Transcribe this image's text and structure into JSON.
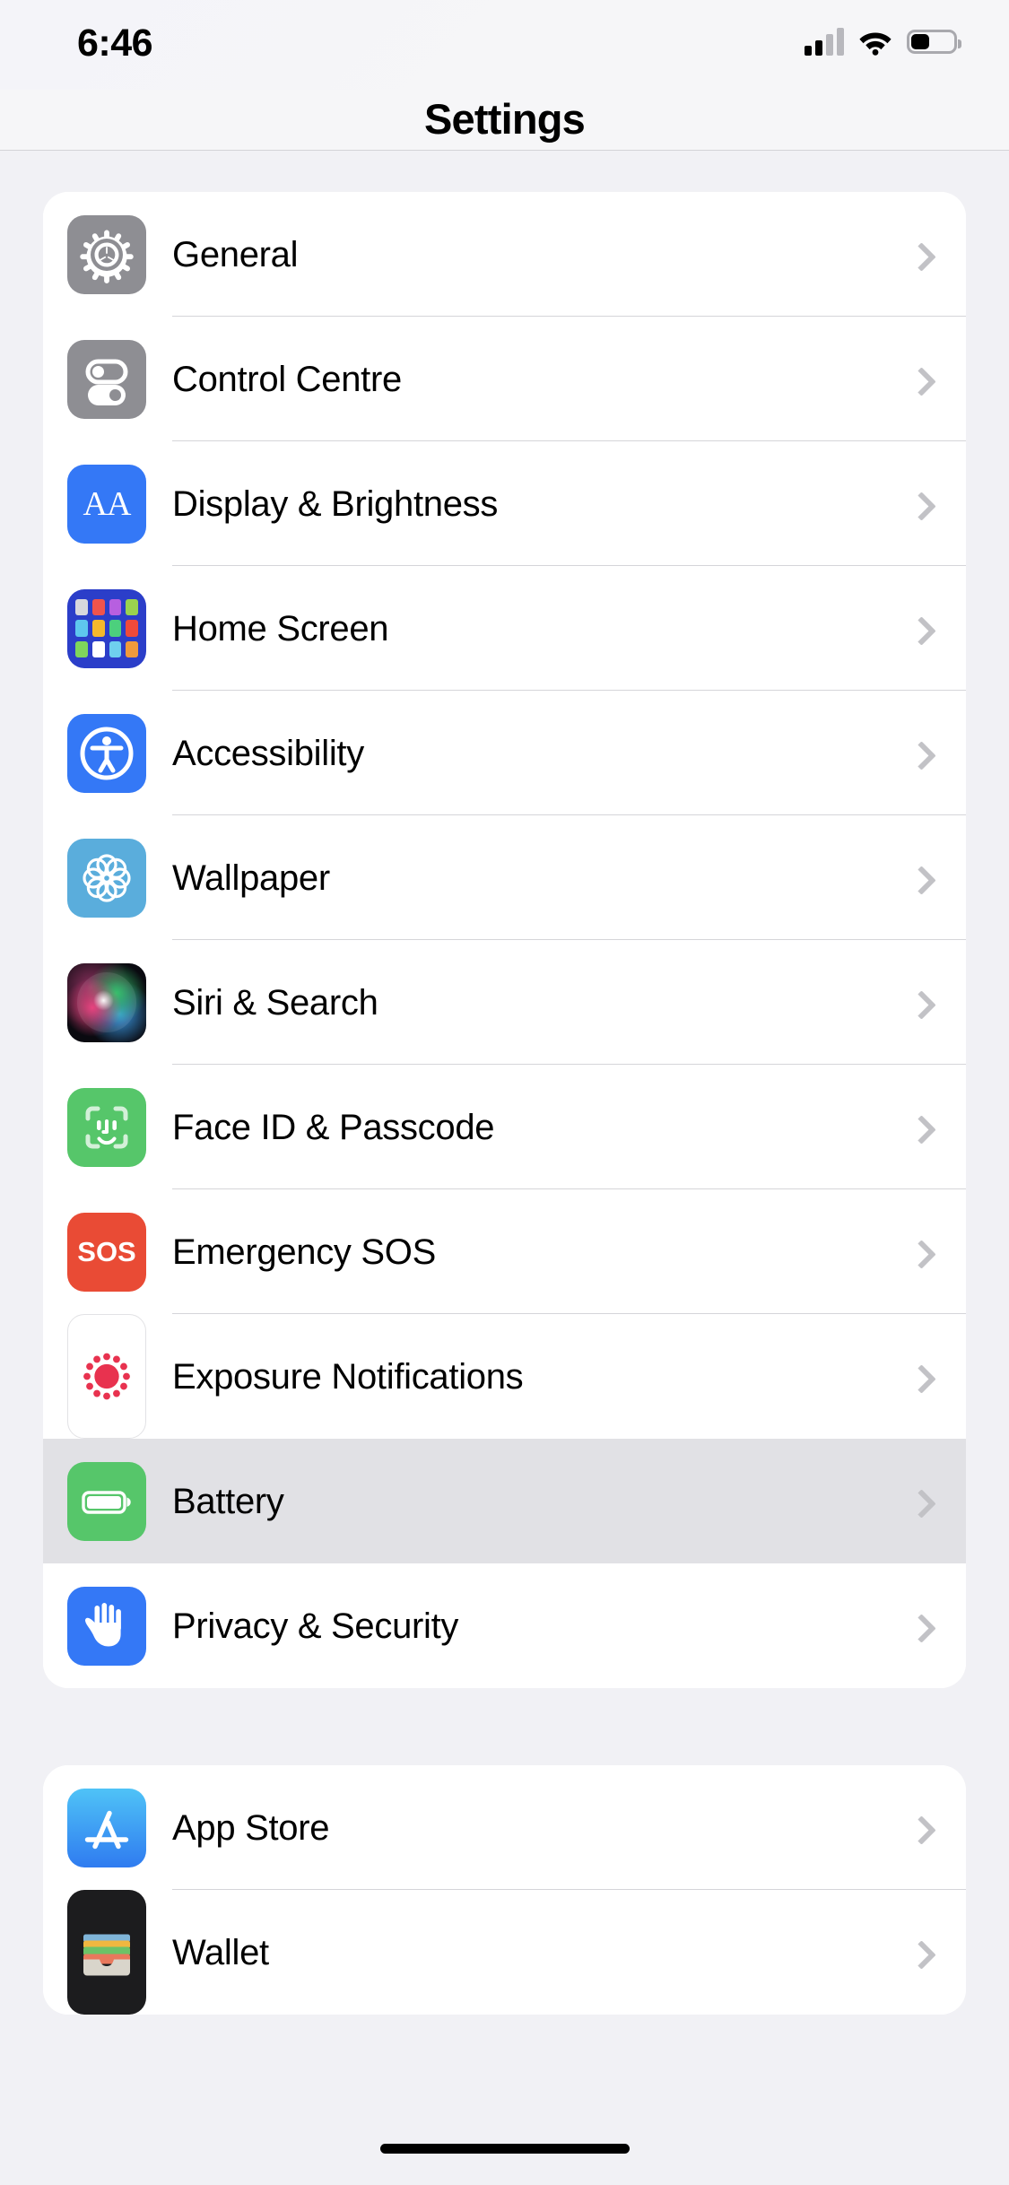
{
  "status_bar": {
    "time": "6:46",
    "cellular_icon": "cellular-signal-icon",
    "cellular_bars_filled": 2,
    "cellular_bars_total": 4,
    "wifi_icon": "wifi-icon",
    "battery_icon": "battery-icon",
    "battery_level_percent": 40
  },
  "nav": {
    "title": "Settings"
  },
  "colors": {
    "page_background": "#f1f1f5",
    "card_background": "#ffffff",
    "highlight_row": "#e1e1e5",
    "separator": "#d5d5d9",
    "chevron": "#c2c2c6",
    "label_text": "#000000"
  },
  "groups": [
    {
      "id": "system-group",
      "rows": [
        {
          "label": "General",
          "icon": "gear-icon",
          "icon_color": "#8e8e93",
          "highlighted": false
        },
        {
          "label": "Control Centre",
          "icon": "toggles-icon",
          "icon_color": "#8e8e93",
          "highlighted": false
        },
        {
          "label": "Display & Brightness",
          "icon": "aa-text-size-icon",
          "icon_color": "#3478f6",
          "highlighted": false
        },
        {
          "label": "Home Screen",
          "icon": "app-grid-icon",
          "icon_color": "#2b3ec9",
          "highlighted": false
        },
        {
          "label": "Accessibility",
          "icon": "accessibility-person-icon",
          "icon_color": "#3478f6",
          "highlighted": false
        },
        {
          "label": "Wallpaper",
          "icon": "flower-wallpaper-icon",
          "icon_color": "#5aaddc",
          "highlighted": false
        },
        {
          "label": "Siri & Search",
          "icon": "siri-orb-icon",
          "icon_color": "#0a0a10",
          "highlighted": false
        },
        {
          "label": "Face ID & Passcode",
          "icon": "face-id-icon",
          "icon_color": "#56c66a",
          "highlighted": false
        },
        {
          "label": "Emergency SOS",
          "icon": "sos-icon",
          "icon_color": "#e94b35",
          "highlighted": false
        },
        {
          "label": "Exposure Notifications",
          "icon": "exposure-notifications-icon",
          "icon_color": "#e8324f",
          "highlighted": false
        },
        {
          "label": "Battery",
          "icon": "battery-green-icon",
          "icon_color": "#56c66a",
          "highlighted": true
        },
        {
          "label": "Privacy & Security",
          "icon": "hand-privacy-icon",
          "icon_color": "#3478f6",
          "highlighted": false
        }
      ]
    },
    {
      "id": "store-group",
      "rows": [
        {
          "label": "App Store",
          "icon": "app-store-icon",
          "icon_color": "#2f9bf2",
          "highlighted": false
        },
        {
          "label": "Wallet",
          "icon": "wallet-icon",
          "icon_color": "#1c1c1e",
          "highlighted": false
        }
      ]
    }
  ],
  "chevron_glyph": "chevron-right-icon",
  "home_indicator": "home-indicator"
}
